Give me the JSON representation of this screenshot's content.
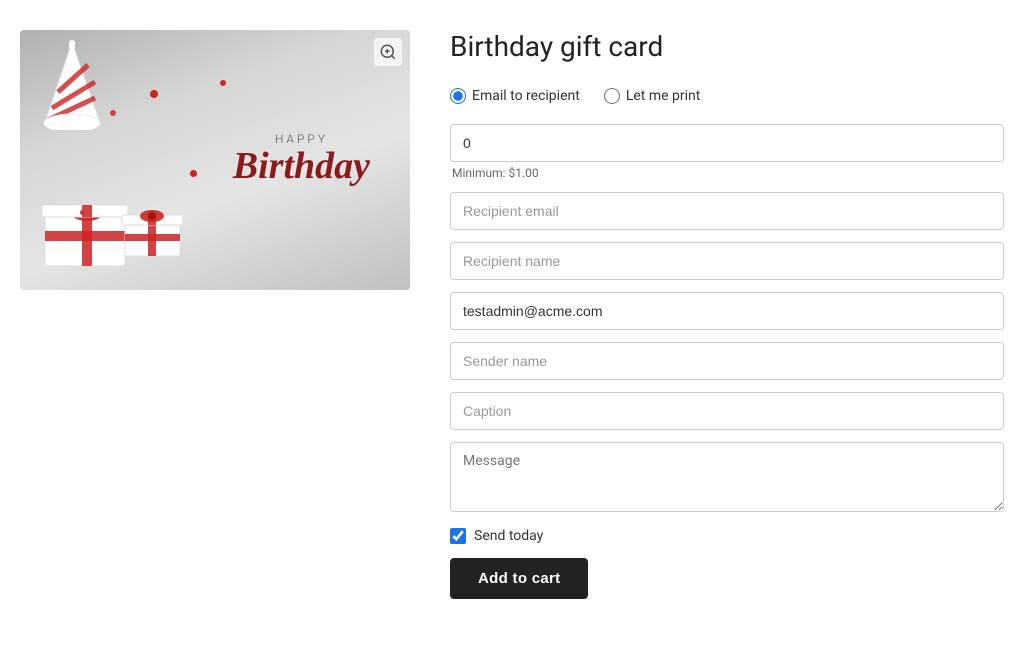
{
  "page": {
    "title": "Birthday gift card"
  },
  "delivery_options": [
    {
      "id": "email",
      "label": "Email to recipient",
      "checked": true
    },
    {
      "id": "print",
      "label": "Let me print",
      "checked": false
    }
  ],
  "form": {
    "amount": {
      "value": "0",
      "placeholder": ""
    },
    "minimum_label": "Minimum: $1.00",
    "recipient_email": {
      "placeholder": "Recipient email",
      "value": ""
    },
    "recipient_name": {
      "placeholder": "Recipient name",
      "value": ""
    },
    "sender_email": {
      "value": "testadmin@acme.com",
      "placeholder": ""
    },
    "sender_name": {
      "placeholder": "Sender name",
      "value": ""
    },
    "caption": {
      "placeholder": "Caption",
      "value": ""
    },
    "message": {
      "placeholder": "Message",
      "value": ""
    },
    "send_today": {
      "label": "Send today",
      "checked": true
    }
  },
  "buttons": {
    "add_to_cart": "Add to cart"
  },
  "image": {
    "happy_text": "HAPPY",
    "birthday_text": "Birthday"
  }
}
